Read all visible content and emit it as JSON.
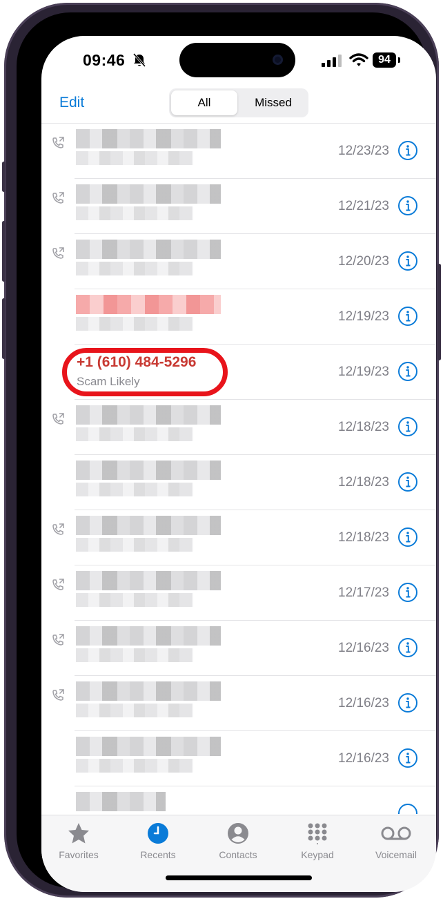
{
  "status": {
    "time": "09:46",
    "battery": "94",
    "silent": true,
    "signal_bars": 4
  },
  "nav": {
    "edit": "Edit",
    "segments": {
      "all": "All",
      "missed": "Missed"
    },
    "selected": "All"
  },
  "calls": [
    {
      "date": "12/23/23",
      "outgoing": true
    },
    {
      "date": "12/21/23",
      "outgoing": true
    },
    {
      "date": "12/20/23",
      "outgoing": true
    },
    {
      "date": "12/19/23",
      "outgoing": false
    },
    {
      "number": "+1 (610) 484-5296",
      "label": "Scam Likely",
      "date": "12/19/23",
      "outgoing": false,
      "highlighted": true
    },
    {
      "date": "12/18/23",
      "outgoing": true
    },
    {
      "date": "12/18/23",
      "outgoing": false
    },
    {
      "date": "12/18/23",
      "outgoing": true
    },
    {
      "date": "12/17/23",
      "outgoing": true
    },
    {
      "date": "12/16/23",
      "outgoing": true
    },
    {
      "date": "12/16/23",
      "outgoing": true
    },
    {
      "date": "12/16/23",
      "outgoing": false
    }
  ],
  "tabs": {
    "favorites": "Favorites",
    "recents": "Recents",
    "contacts": "Contacts",
    "keypad": "Keypad",
    "voicemail": "Voicemail"
  },
  "colors": {
    "accent": "#0a7bd8",
    "scam_text": "#c83a33",
    "highlight_circle": "#e8141b"
  },
  "icons": {
    "edit": "none",
    "info": "info-circle-icon",
    "call": "outgoing-call-icon"
  }
}
